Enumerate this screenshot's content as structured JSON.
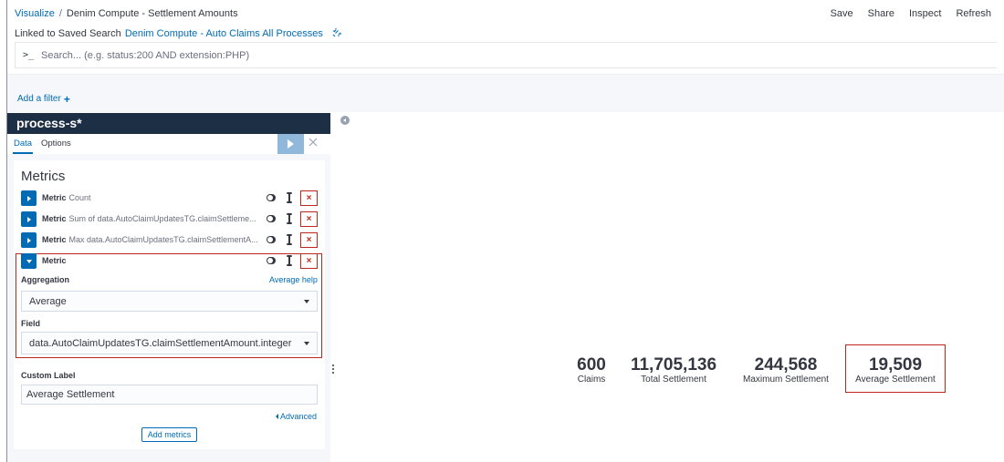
{
  "breadcrumb": {
    "root": "Visualize",
    "separator": "/",
    "current": "Denim Compute - Settlement Amounts"
  },
  "top_menu": [
    "Save",
    "Share",
    "Inspect",
    "Refresh"
  ],
  "linked": {
    "prefix": "Linked to Saved Search",
    "search_name": "Denim Compute - Auto Claims All Processes"
  },
  "search": {
    "prompt": ">_",
    "placeholder": "Search... (e.g. status:200 AND extension:PHP)"
  },
  "filters": {
    "add_label": "Add a filter",
    "add_symbol": "+"
  },
  "editor": {
    "index_pattern": "process-s*",
    "tabs": [
      "Data",
      "Options"
    ],
    "metrics_title": "Metrics",
    "metric_rows": [
      {
        "kind": "Metric",
        "desc": "Count"
      },
      {
        "kind": "Metric",
        "desc": "Sum of data.AutoClaimUpdatesTG.claimSettleme..."
      },
      {
        "kind": "Metric",
        "desc": "Max data.AutoClaimUpdatesTG.claimSettlementA..."
      },
      {
        "kind": "Metric",
        "desc": ""
      }
    ],
    "delete_symbol": "×",
    "aggregation_label": "Aggregation",
    "aggregation_help": "Average help",
    "aggregation_value": "Average",
    "field_label": "Field",
    "field_value": "data.AutoClaimUpdatesTG.claimSettlementAmount.integer",
    "custom_label_label": "Custom Label",
    "custom_label_value": "Average Settlement",
    "advanced_label": "Advanced",
    "add_metrics_label": "Add metrics"
  },
  "visualization": [
    {
      "value": "600",
      "label": "Claims"
    },
    {
      "value": "11,705,136",
      "label": "Total Settlement"
    },
    {
      "value": "244,568",
      "label": "Maximum Settlement"
    },
    {
      "value": "19,509",
      "label": "Average Settlement"
    }
  ],
  "colors": {
    "accent": "#006bb4",
    "title_bar": "#1d2f44",
    "danger": "#bd271e",
    "apply_button": "#8fb8db"
  }
}
